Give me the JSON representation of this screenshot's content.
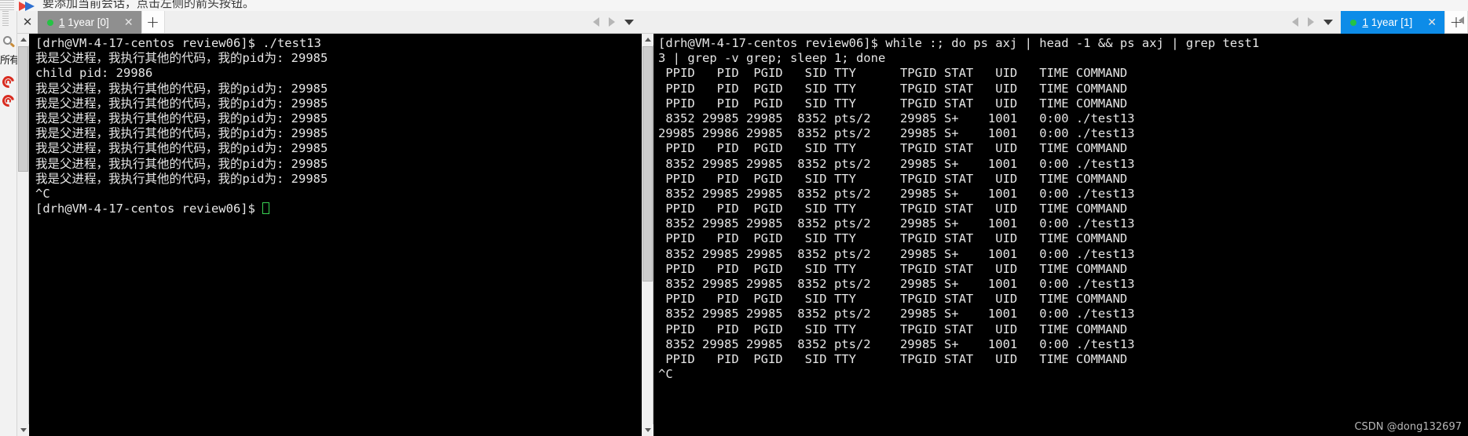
{
  "hint": {
    "text": "要添加当前会话，点击左侧的箭头按钮。",
    "flag_icon": "bookmark-flag-icon"
  },
  "rail": {
    "search_icon": "search-icon",
    "label": "所有",
    "spiral_icon": "spiral-icon"
  },
  "left_panel": {
    "close_all_label": "✕",
    "tab": {
      "index": "1",
      "name": "1year [0]",
      "close_label": "✕",
      "status_dot_color": "#25c344",
      "bg_color": "#8f8f8f"
    },
    "new_tab_label": "+",
    "nav": {
      "prev_icon": "arrow-left-icon",
      "next_icon": "arrow-right-icon",
      "menu_icon": "chevron-down-icon"
    },
    "terminal_lines": [
      "[drh@VM-4-17-centos review06]$ ./test13",
      "我是父进程，我执行其他的代码，我的pid为: 29985",
      "child pid: 29986",
      "我是父进程，我执行其他的代码，我的pid为: 29985",
      "我是父进程，我执行其他的代码，我的pid为: 29985",
      "我是父进程，我执行其他的代码，我的pid为: 29985",
      "我是父进程，我执行其他的代码，我的pid为: 29985",
      "我是父进程，我执行其他的代码，我的pid为: 29985",
      "我是父进程，我执行其他的代码，我的pid为: 29985",
      "我是父进程，我执行其他的代码，我的pid为: 29985",
      "^C",
      "[drh@VM-4-17-centos review06]$ "
    ]
  },
  "right_panel": {
    "tab": {
      "index": "1",
      "name": "1year [1]",
      "close_label": "✕",
      "status_dot_color": "#25c344",
      "bg_color": "#0d8ce8"
    },
    "new_tab_label": "+",
    "nav": {
      "prev_icon": "arrow-left-icon",
      "next_icon": "arrow-right-icon",
      "menu_icon": "chevron-down-icon"
    },
    "terminal_lines": [
      "[drh@VM-4-17-centos review06]$ while :; do ps axj | head -1 && ps axj | grep test1",
      "3 | grep -v grep; sleep 1; done",
      " PPID   PID  PGID   SID TTY      TPGID STAT   UID   TIME COMMAND",
      " PPID   PID  PGID   SID TTY      TPGID STAT   UID   TIME COMMAND",
      " PPID   PID  PGID   SID TTY      TPGID STAT   UID   TIME COMMAND",
      " 8352 29985 29985  8352 pts/2    29985 S+    1001   0:00 ./test13",
      "29985 29986 29985  8352 pts/2    29985 S+    1001   0:00 ./test13",
      " PPID   PID  PGID   SID TTY      TPGID STAT   UID   TIME COMMAND",
      " 8352 29985 29985  8352 pts/2    29985 S+    1001   0:00 ./test13",
      " PPID   PID  PGID   SID TTY      TPGID STAT   UID   TIME COMMAND",
      " 8352 29985 29985  8352 pts/2    29985 S+    1001   0:00 ./test13",
      " PPID   PID  PGID   SID TTY      TPGID STAT   UID   TIME COMMAND",
      " 8352 29985 29985  8352 pts/2    29985 S+    1001   0:00 ./test13",
      " PPID   PID  PGID   SID TTY      TPGID STAT   UID   TIME COMMAND",
      " 8352 29985 29985  8352 pts/2    29985 S+    1001   0:00 ./test13",
      " PPID   PID  PGID   SID TTY      TPGID STAT   UID   TIME COMMAND",
      " 8352 29985 29985  8352 pts/2    29985 S+    1001   0:00 ./test13",
      " PPID   PID  PGID   SID TTY      TPGID STAT   UID   TIME COMMAND",
      " 8352 29985 29985  8352 pts/2    29985 S+    1001   0:00 ./test13",
      " PPID   PID  PGID   SID TTY      TPGID STAT   UID   TIME COMMAND",
      " 8352 29985 29985  8352 pts/2    29985 S+    1001   0:00 ./test13",
      " PPID   PID  PGID   SID TTY      TPGID STAT   UID   TIME COMMAND",
      "^C"
    ]
  },
  "watermark": "CSDN @dong132697"
}
